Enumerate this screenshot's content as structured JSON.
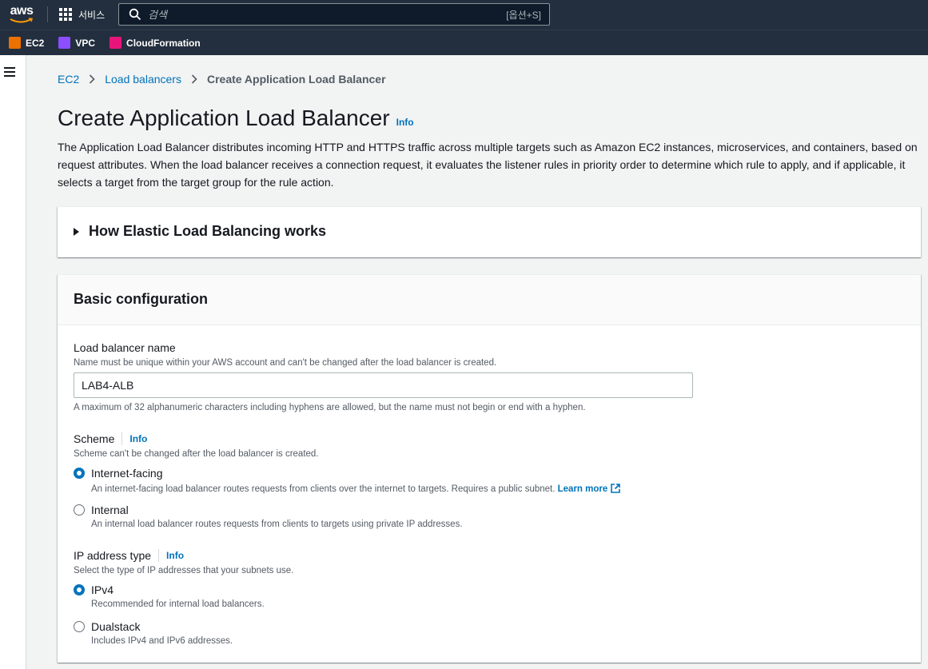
{
  "topnav": {
    "logo_text": "aws",
    "services_label": "서비스",
    "search_placeholder": "검색",
    "search_shortcut": "[옵션+S]"
  },
  "favorites": [
    {
      "label": "EC2",
      "color": "#ed7100"
    },
    {
      "label": "VPC",
      "color": "#8c4fff"
    },
    {
      "label": "CloudFormation",
      "color": "#e7157b"
    }
  ],
  "breadcrumb": {
    "items": [
      "EC2",
      "Load balancers"
    ],
    "current": "Create Application Load Balancer"
  },
  "page": {
    "title": "Create Application Load Balancer",
    "info": "Info",
    "description": "The Application Load Balancer distributes incoming HTTP and HTTPS traffic across multiple targets such as Amazon EC2 instances, microservices, and containers, based on request attributes. When the load balancer receives a connection request, it evaluates the listener rules in priority order to determine which rule to apply, and if applicable, it selects a target from the target group for the rule action."
  },
  "how_panel": {
    "title": "How Elastic Load Balancing works"
  },
  "basic": {
    "title": "Basic configuration",
    "name_label": "Load balancer name",
    "name_desc": "Name must be unique within your AWS account and can't be changed after the load balancer is created.",
    "name_value": "LAB4-ALB",
    "name_constraint": "A maximum of 32 alphanumeric characters including hyphens are allowed, but the name must not begin or end with a hyphen.",
    "scheme_label": "Scheme",
    "scheme_info": "Info",
    "scheme_desc": "Scheme can't be changed after the load balancer is created.",
    "scheme_options": [
      {
        "title": "Internet-facing",
        "sub": "An internet-facing load balancer routes requests from clients over the internet to targets. Requires a public subnet.",
        "link": "Learn more",
        "checked": true
      },
      {
        "title": "Internal",
        "sub": "An internal load balancer routes requests from clients to targets using private IP addresses.",
        "checked": false
      }
    ],
    "ip_label": "IP address type",
    "ip_info": "Info",
    "ip_desc": "Select the type of IP addresses that your subnets use.",
    "ip_options": [
      {
        "title": "IPv4",
        "sub": "Recommended for internal load balancers.",
        "checked": true
      },
      {
        "title": "Dualstack",
        "sub": "Includes IPv4 and IPv6 addresses.",
        "checked": false
      }
    ]
  },
  "colors": {
    "nav_bg": "#232f3e",
    "link": "#0073bb",
    "radio_selected": "#0073bb"
  }
}
